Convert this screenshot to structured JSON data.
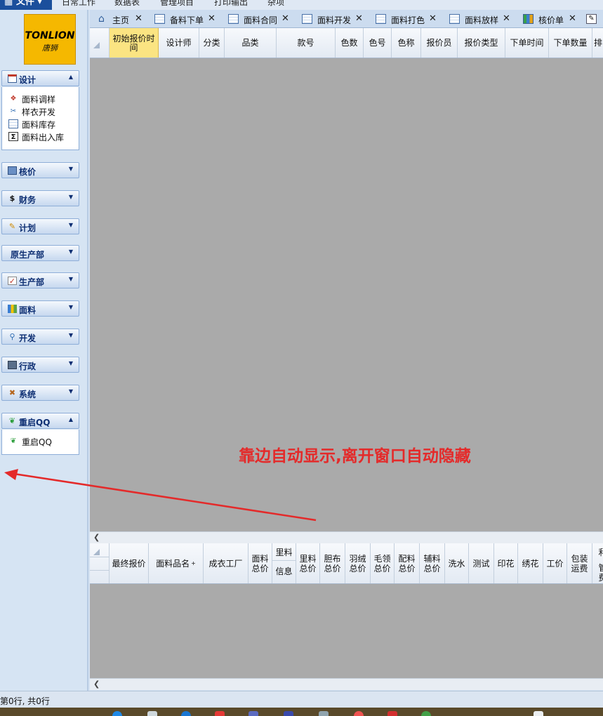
{
  "menu": {
    "file": "文件",
    "items": [
      "日常工作",
      "数据表",
      "管理项目",
      "打印输出",
      "杂项"
    ]
  },
  "logo": {
    "line1": "TONLION",
    "line2": "唐狮"
  },
  "sidebar": {
    "sections": [
      {
        "label": "设计",
        "icon": "design-icon",
        "expanded": true
      },
      {
        "label": "核价",
        "icon": "pricing-icon",
        "expanded": false
      },
      {
        "label": "财务",
        "icon": "dollar-icon",
        "expanded": false
      },
      {
        "label": "计划",
        "icon": "plan-icon",
        "expanded": false
      },
      {
        "label": "原生产部",
        "icon": "",
        "expanded": false
      },
      {
        "label": "生产部",
        "icon": "checklist-icon",
        "expanded": false
      },
      {
        "label": "面料",
        "icon": "fabric-icon",
        "expanded": false
      },
      {
        "label": "开发",
        "icon": "search-icon",
        "expanded": false
      },
      {
        "label": "行政",
        "icon": "admin-icon",
        "expanded": false
      },
      {
        "label": "系统",
        "icon": "tools-icon",
        "expanded": false
      },
      {
        "label": "重启QQ",
        "icon": "qq-icon",
        "expanded": true
      }
    ],
    "design_items": [
      "面料调样",
      "样衣开发",
      "面料库存",
      "面料出入库"
    ],
    "qq_items": [
      "重启QQ"
    ]
  },
  "tabs": [
    {
      "label": "主页",
      "icon": "home-icon"
    },
    {
      "label": "备料下单",
      "icon": "grid-icon"
    },
    {
      "label": "面料合同",
      "icon": "grid-icon"
    },
    {
      "label": "面料开发",
      "icon": "grid-icon"
    },
    {
      "label": "面料打色",
      "icon": "grid-icon"
    },
    {
      "label": "面料放样",
      "icon": "grid-icon"
    },
    {
      "label": "核价单",
      "icon": "chart-icon"
    }
  ],
  "top_grid": {
    "columns": [
      "初始报价时间",
      "设计师",
      "分类",
      "品类",
      "款号",
      "色数",
      "色号",
      "色称",
      "报价员",
      "报价类型",
      "下单时间",
      "下单数量",
      "排"
    ]
  },
  "bottom_grid": {
    "columns": [
      "最终报价",
      "面料品名",
      "成衣工厂",
      "面料总价",
      "里料",
      "信息",
      "里料总价",
      "胆布总价",
      "羽绒总价",
      "毛领总价",
      "配料总价",
      "辅料总价",
      "洗水",
      "测试",
      "印花",
      "绣花",
      "工价",
      "包装运费",
      "利",
      "管",
      "费"
    ],
    "sort_marker": "+"
  },
  "annotation": "靠边自动显示,离开窗口自动隐藏",
  "status": "第0行, 共0行",
  "colors": {
    "accent": "#1b4f9c",
    "logo_bg": "#f5b800",
    "annotation": "#e42a2a",
    "grid_bg": "#aaaaaa",
    "selected_header": "#fbe482"
  }
}
